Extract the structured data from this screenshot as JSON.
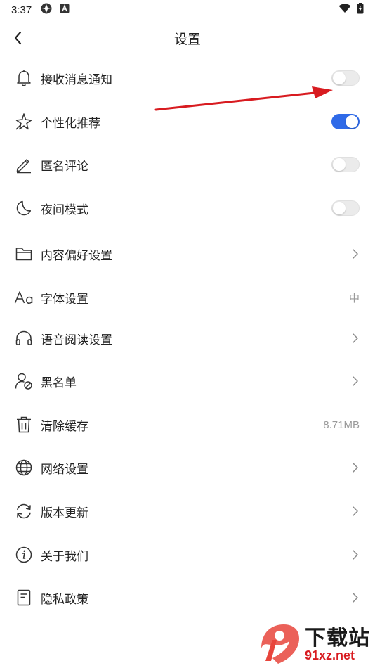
{
  "status_bar": {
    "time": "3:37"
  },
  "header": {
    "title": "设置"
  },
  "items": [
    {
      "id": "notify",
      "label": "接收消息通知",
      "control": "toggle",
      "on": false,
      "icon": "bell-icon"
    },
    {
      "id": "personal",
      "label": "个性化推荐",
      "control": "toggle",
      "on": true,
      "icon": "sparkle-icon"
    },
    {
      "id": "anon",
      "label": "匿名评论",
      "control": "toggle",
      "on": false,
      "icon": "pencil-icon"
    },
    {
      "id": "night",
      "label": "夜间模式",
      "control": "toggle",
      "on": false,
      "icon": "moon-icon"
    },
    {
      "id": "content",
      "label": "内容偏好设置",
      "control": "chevron",
      "icon": "folder-icon"
    },
    {
      "id": "font",
      "label": "字体设置",
      "control": "value",
      "value": "中",
      "icon": "font-icon"
    },
    {
      "id": "voice",
      "label": "语音阅读设置",
      "control": "chevron",
      "icon": "headphones-icon"
    },
    {
      "id": "blacklist",
      "label": "黑名单",
      "control": "chevron",
      "icon": "user-block-icon"
    },
    {
      "id": "cache",
      "label": "清除缓存",
      "control": "value",
      "value": "8.71MB",
      "icon": "trash-icon"
    },
    {
      "id": "network",
      "label": "网络设置",
      "control": "chevron",
      "icon": "globe-icon"
    },
    {
      "id": "update",
      "label": "版本更新",
      "control": "chevron",
      "icon": "refresh-icon"
    },
    {
      "id": "about",
      "label": "关于我们",
      "control": "chevron",
      "icon": "info-icon"
    },
    {
      "id": "privacy",
      "label": "隐私政策",
      "control": "chevron",
      "icon": "document-icon"
    }
  ],
  "watermark": {
    "title": "下载站",
    "subtitle": "91xz.net"
  },
  "colors": {
    "accent": "#2f6ae8",
    "arrow": "#d81b20",
    "muted": "#9a9a9a"
  }
}
